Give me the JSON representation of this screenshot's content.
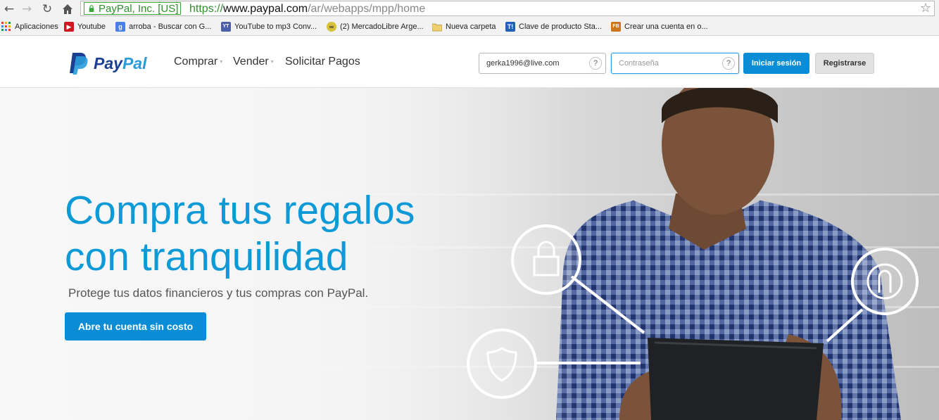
{
  "browser": {
    "ev_badge": "PayPal, Inc. [US]",
    "url_scheme": "https://",
    "url_host": "www.paypal.com",
    "url_path": "/ar/webapps/mpp/home",
    "back_icon": "back-arrow-icon",
    "forward_icon": "forward-arrow-icon",
    "reload_icon": "reload-icon",
    "home_icon": "home-icon",
    "star_icon": "bookmark-star-icon"
  },
  "bookmarks": [
    {
      "label": "Aplicaciones",
      "icon": "apps-grid-icon",
      "color": "#e34234"
    },
    {
      "label": "Youtube",
      "icon": "youtube-icon",
      "color": "#cc181e"
    },
    {
      "label": "arroba - Buscar con G...",
      "icon": "google-icon",
      "color": "#4a7fe6"
    },
    {
      "label": "YouTube to mp3 Conv...",
      "icon": "yt-mp3-icon",
      "color": "#4a5fa8"
    },
    {
      "label": "(2) MercadoLibre Arge...",
      "icon": "mercadolibre-icon",
      "color": "#d8c23a"
    },
    {
      "label": "Nueva carpeta",
      "icon": "folder-icon",
      "color": "#e9c25a"
    },
    {
      "label": "Clave de producto Sta...",
      "icon": "t-icon",
      "color": "#1f62b5"
    },
    {
      "label": "Crear una cuenta en o...",
      "icon": "fb-icon",
      "color": "#c9761e"
    }
  ],
  "header": {
    "logo_pay": "Pay",
    "logo_pal": "Pal",
    "nav": [
      {
        "label": "Comprar",
        "caret": "▾"
      },
      {
        "label": "Vender",
        "caret": "▾"
      },
      {
        "label": "Solicitar Pagos",
        "caret": ""
      }
    ],
    "email_value": "gerka1996@live.com",
    "password_placeholder": "Contraseña",
    "help": "?",
    "login_label": "Iniciar sesión",
    "register_label": "Registrarse"
  },
  "hero": {
    "title_line1": "Compra tus regalos",
    "title_line2": "con tranquilidad",
    "subtitle": "Protege tus datos financieros y tus compras con PayPal.",
    "cta": "Abre tu cuenta sin costo",
    "overlay_icons": [
      "lock-icon",
      "shield-icon",
      "user-icon"
    ]
  },
  "colors": {
    "brand_dark": "#1b3f91",
    "brand_light": "#2a9bd9",
    "accent": "#0b8dd6",
    "headline": "#0e9ad7"
  }
}
